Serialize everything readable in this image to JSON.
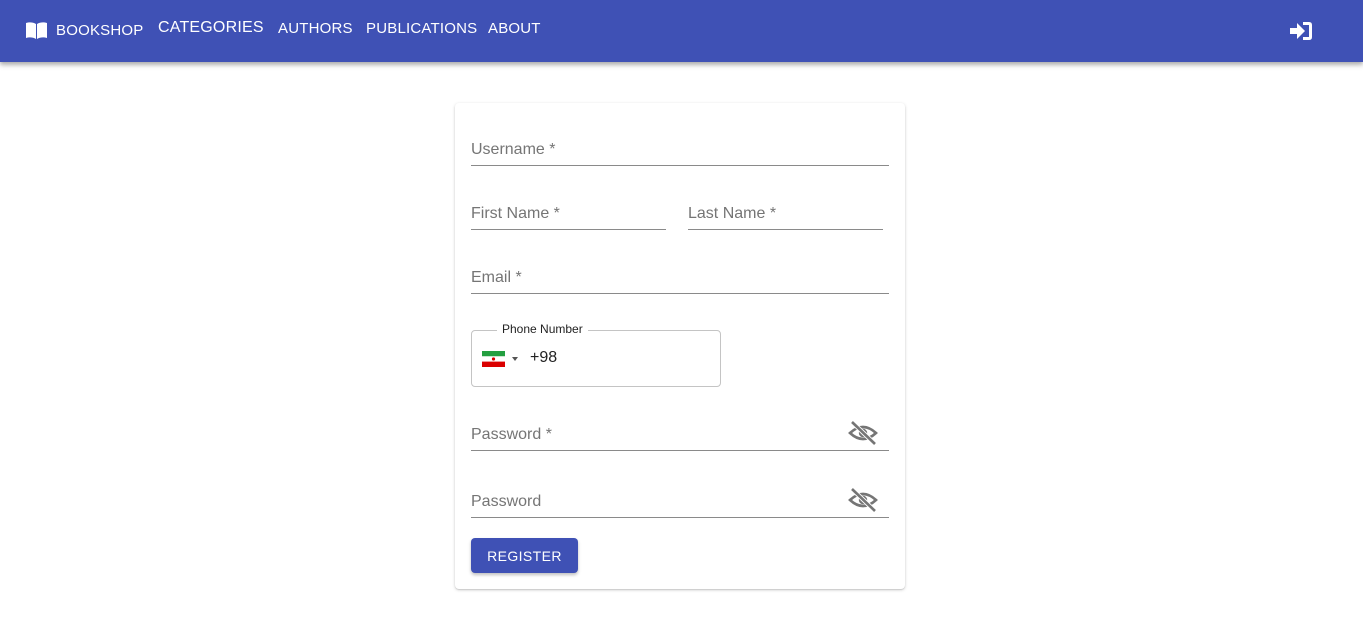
{
  "navbar": {
    "brand_label": "BOOKSHOP",
    "brand_icon": "open-book-icon",
    "links": [
      "CATEGORIES",
      "AUTHORS",
      "PUBLICATIONS",
      "ABOUT"
    ],
    "login_icon": "sign-in-icon",
    "color": "#3f51b5"
  },
  "form": {
    "username_label": "Username *",
    "first_name_label": "First Name *",
    "last_name_label": "Last Name *",
    "email_label": "Email *",
    "phone": {
      "legend": "Phone Number",
      "country_flag": "iran-flag-icon",
      "value": "+98"
    },
    "password_label": "Password *",
    "confirm_password_label": "Password",
    "visibility_icon": "visibility-off-icon",
    "register_label": "REGISTER"
  }
}
